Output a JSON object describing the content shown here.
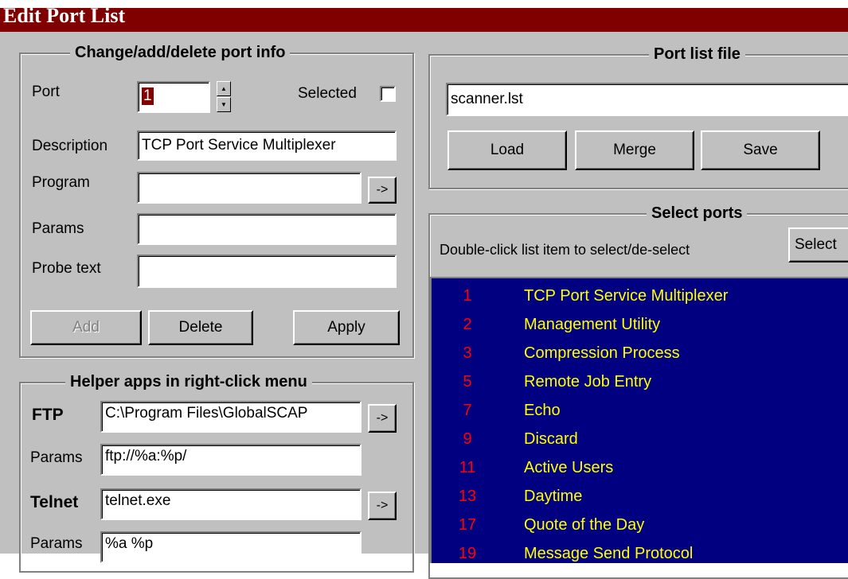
{
  "window": {
    "title": "Edit Port List"
  },
  "port_info": {
    "group_title": "Change/add/delete port info",
    "port_label": "Port",
    "port_value": "1",
    "selected_label": "Selected",
    "selected_checked": false,
    "description_label": "Description",
    "description_value": "TCP Port Service Multiplexer",
    "program_label": "Program",
    "program_value": "",
    "program_browse": "->",
    "params_label": "Params",
    "params_value": "",
    "probe_label": "Probe text",
    "probe_value": "",
    "add_label": "Add",
    "delete_label": "Delete",
    "apply_label": "Apply"
  },
  "helper_apps": {
    "group_title": "Helper apps in right-click menu",
    "ftp_label": "FTP",
    "ftp_value": "C:\\Program Files\\GlobalSCAP",
    "ftp_browse": "->",
    "ftp_params_label": "Params",
    "ftp_params_value": "ftp://%a:%p/",
    "telnet_label": "Telnet",
    "telnet_value": "telnet.exe",
    "telnet_browse": "->",
    "telnet_params_label": "Params",
    "telnet_params_value": "%a %p"
  },
  "port_list_file": {
    "group_title": "Port list file",
    "file_value": "scanner.lst",
    "load_label": "Load",
    "merge_label": "Merge",
    "save_label": "Save"
  },
  "select_ports": {
    "group_title": "Select ports",
    "hint": "Double-click list item to select/de-select",
    "select_button": "Select",
    "items": [
      {
        "port": "1",
        "description": "TCP Port Service Multiplexer"
      },
      {
        "port": "2",
        "description": "Management Utility"
      },
      {
        "port": "3",
        "description": "Compression Process"
      },
      {
        "port": "5",
        "description": "Remote Job Entry"
      },
      {
        "port": "7",
        "description": "Echo"
      },
      {
        "port": "9",
        "description": "Discard"
      },
      {
        "port": "11",
        "description": "Active Users"
      },
      {
        "port": "13",
        "description": "Daytime"
      },
      {
        "port": "17",
        "description": "Quote of the Day"
      },
      {
        "port": "19",
        "description": "Message Send Protocol"
      }
    ]
  },
  "colors": {
    "title_bar": "#800000",
    "list_background": "#000080",
    "port_number": "#ff0000",
    "port_description": "#ffff00",
    "face": "#c0c0c0"
  }
}
